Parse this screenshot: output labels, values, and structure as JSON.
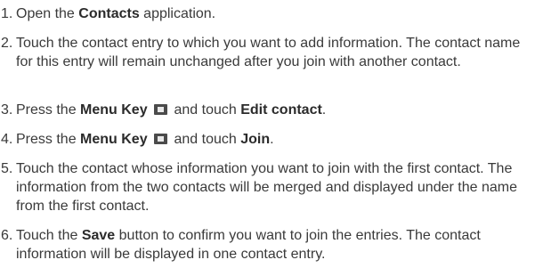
{
  "steps": [
    {
      "num": "1.",
      "pre": "Open the ",
      "bold": "Contacts",
      "post": " application."
    },
    {
      "num": "2.",
      "text": "Touch the contact entry to which you want to add information. The contact name for this entry will remain unchanged after you join with another contact."
    },
    {
      "num": "3.",
      "pre": "Press the ",
      "bold1": "Menu Key",
      "icon": "menu-key-icon",
      "mid": " and touch ",
      "bold2": "Edit contact",
      "post": "."
    },
    {
      "num": "4.",
      "pre": "Press the ",
      "bold1": "Menu Key",
      "icon": "menu-key-icon",
      "mid": " and touch ",
      "bold2": "Join",
      "post": "."
    },
    {
      "num": "5.",
      "text": "Touch the contact whose information you want to join with the first contact. The information from the two contacts will be merged and displayed under the name from the first contact."
    },
    {
      "num": "6.",
      "pre": "Touch the ",
      "bold": "Save",
      "post": " button to confirm you want to join the entries. The contact information will be displayed in one contact entry."
    }
  ]
}
